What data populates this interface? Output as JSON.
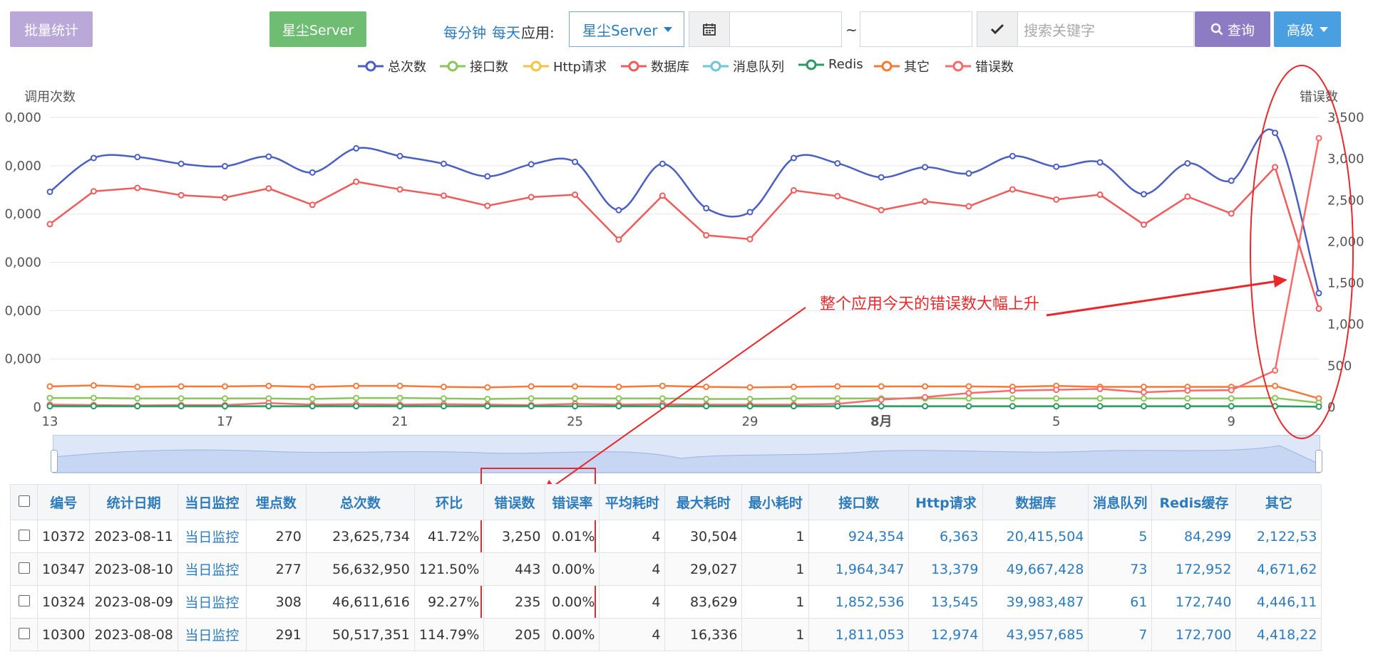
{
  "toolbar": {
    "batch_stats_label": "批量统计",
    "app_button_label": "星尘Server",
    "per_minute_label": "每分钟",
    "per_day_label": "每天",
    "app_label": "应用:",
    "app_select_value": "星尘Server",
    "date_separator": "~",
    "search_placeholder": "搜索关键字",
    "query_label": "查询",
    "advanced_label": "高级"
  },
  "colors": {
    "total": "#4a5fc1",
    "api": "#8bc65a",
    "http": "#f7c244",
    "db": "#ee5c5c",
    "mq": "#6dc5d8",
    "redis": "#2d9a64",
    "other": "#f47a3c",
    "error": "#f76b6b",
    "annotation": "#e8282b"
  },
  "legend": [
    {
      "label": "总次数",
      "color": "#4a5fc1"
    },
    {
      "label": "接口数",
      "color": "#8bc65a"
    },
    {
      "label": "Http请求",
      "color": "#f7c244"
    },
    {
      "label": "数据库",
      "color": "#ee5c5c"
    },
    {
      "label": "消息队列",
      "color": "#6dc5d8"
    },
    {
      "label": "Redis",
      "color": "#2d9a64"
    },
    {
      "label": "其它",
      "color": "#f47a3c"
    },
    {
      "label": "错误数",
      "color": "#f76b6b"
    }
  ],
  "chart_data": {
    "type": "line",
    "ylabel_left": "调用次数",
    "ylabel_right": "错误数",
    "left_tick_labels": [
      "0",
      "0,000",
      "0,000",
      "0,000",
      "0,000",
      "0,000",
      "0,000"
    ],
    "right_ticks": [
      0,
      500,
      1000,
      1500,
      2000,
      2500,
      3000,
      3500
    ],
    "right_tick_labels": [
      "0",
      "500",
      "1,000",
      "1,500",
      "2,000",
      "2,500",
      "3,000",
      "3,500"
    ],
    "ylim_left": [
      0,
      60
    ],
    "ylim_right": [
      0,
      3500
    ],
    "x_tick_labels": [
      {
        "index": 0,
        "label": "13"
      },
      {
        "index": 4,
        "label": "17"
      },
      {
        "index": 8,
        "label": "21"
      },
      {
        "index": 12,
        "label": "25"
      },
      {
        "index": 16,
        "label": "29"
      },
      {
        "index": 19,
        "label": "8月"
      },
      {
        "index": 23,
        "label": "5"
      },
      {
        "index": 27,
        "label": "9"
      }
    ],
    "x_count": 30,
    "series": [
      {
        "name": "总次数",
        "axis": "left",
        "smooth": true,
        "values": [
          44.6,
          51.6,
          51.8,
          50.4,
          49.9,
          51.9,
          48.6,
          53.6,
          52.0,
          50.4,
          47.8,
          50.3,
          50.8,
          40.8,
          50.4,
          41.2,
          40.4,
          51.6,
          50.5,
          47.6,
          49.7,
          48.4,
          52.0,
          49.8,
          50.7,
          44.1,
          50.5,
          46.9,
          56.8,
          23.6
        ]
      },
      {
        "name": "数据库",
        "axis": "left",
        "smooth": false,
        "values": [
          37.9,
          44.7,
          45.4,
          43.9,
          43.4,
          45.3,
          41.9,
          46.7,
          45.1,
          43.8,
          41.7,
          43.5,
          44.0,
          34.7,
          43.8,
          35.6,
          34.8,
          44.9,
          43.7,
          40.8,
          42.6,
          41.6,
          45.1,
          43.0,
          44.0,
          37.8,
          43.6,
          40.1,
          49.7,
          20.4
        ]
      },
      {
        "name": "其它",
        "axis": "left",
        "smooth": false,
        "values": [
          4.3,
          4.5,
          4.2,
          4.3,
          4.3,
          4.4,
          4.2,
          4.4,
          4.4,
          4.2,
          4.1,
          4.3,
          4.3,
          4.2,
          4.4,
          4.2,
          4.1,
          4.2,
          4.3,
          4.3,
          4.3,
          4.3,
          4.2,
          4.4,
          4.2,
          4.2,
          4.2,
          4.2,
          4.4,
          1.8
        ]
      },
      {
        "name": "接口数",
        "axis": "left",
        "smooth": false,
        "values": [
          1.9,
          1.9,
          1.8,
          1.8,
          1.8,
          1.8,
          1.7,
          1.9,
          1.9,
          1.8,
          1.7,
          1.8,
          1.8,
          1.8,
          1.8,
          1.7,
          1.7,
          1.8,
          1.8,
          1.8,
          1.8,
          1.8,
          1.8,
          1.8,
          1.8,
          1.8,
          1.8,
          1.8,
          1.9,
          0.9
        ]
      },
      {
        "name": "错误数",
        "axis": "right",
        "smooth": false,
        "values": [
          30,
          25,
          20,
          25,
          25,
          50,
          30,
          35,
          30,
          35,
          30,
          25,
          40,
          30,
          35,
          30,
          30,
          30,
          40,
          90,
          120,
          170,
          200,
          210,
          220,
          180,
          200,
          205,
          443,
          3250
        ]
      },
      {
        "name": "Redis",
        "axis": "left",
        "smooth": false,
        "values": [
          0.2,
          0.2,
          0.2,
          0.2,
          0.2,
          0.2,
          0.2,
          0.2,
          0.2,
          0.2,
          0.2,
          0.2,
          0.2,
          0.2,
          0.2,
          0.2,
          0.2,
          0.2,
          0.2,
          0.2,
          0.2,
          0.2,
          0.2,
          0.2,
          0.2,
          0.2,
          0.2,
          0.2,
          0.2,
          0.1
        ]
      }
    ]
  },
  "annotation": {
    "text": "整个应用今天的错误数大幅上升"
  },
  "table": {
    "headers": [
      "编号",
      "统计日期",
      "当日监控",
      "埋点数",
      "总次数",
      "环比",
      "错误数",
      "错误率",
      "平均耗时",
      "最大耗时",
      "最小耗时",
      "接口数",
      "Http请求",
      "数据库",
      "消息队列",
      "Redis缓存",
      "其它"
    ],
    "rows": [
      [
        "10372",
        "2023-08-11",
        "当日监控",
        "270",
        "23,625,734",
        "41.72%",
        "3,250",
        "0.01%",
        "4",
        "30,504",
        "1",
        "924,354",
        "6,363",
        "20,415,504",
        "5",
        "84,299",
        "2,122,53"
      ],
      [
        "10347",
        "2023-08-10",
        "当日监控",
        "277",
        "56,632,950",
        "121.50%",
        "443",
        "0.00%",
        "4",
        "29,027",
        "1",
        "1,964,347",
        "13,379",
        "49,667,428",
        "73",
        "172,952",
        "4,671,62"
      ],
      [
        "10324",
        "2023-08-09",
        "当日监控",
        "308",
        "46,611,616",
        "92.27%",
        "235",
        "0.00%",
        "4",
        "83,629",
        "1",
        "1,852,536",
        "13,545",
        "39,983,487",
        "61",
        "172,740",
        "4,446,11"
      ],
      [
        "10300",
        "2023-08-08",
        "当日监控",
        "291",
        "50,517,351",
        "114.79%",
        "205",
        "0.00%",
        "4",
        "16,336",
        "1",
        "1,811,053",
        "12,974",
        "43,957,685",
        "7",
        "172,700",
        "4,418,22"
      ]
    ]
  }
}
